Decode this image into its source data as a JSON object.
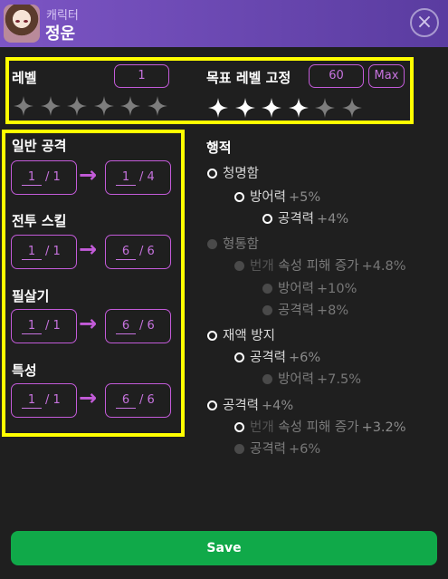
{
  "header": {
    "subtitle": "캐릭터",
    "name": "정운",
    "close_icon": "×"
  },
  "level": {
    "label": "레벨",
    "value": "1"
  },
  "target": {
    "label": "목표 레벨 고정",
    "value": "60",
    "max_label": "Max"
  },
  "level_stars": {
    "total": 6,
    "filled": 0
  },
  "target_stars": {
    "total": 6,
    "filled": 4
  },
  "skills": [
    {
      "label": "일반 공격",
      "from_cur": "1",
      "from_max": "1",
      "to_cur": "1",
      "to_max": "4"
    },
    {
      "label": "전투 스킬",
      "from_cur": "1",
      "from_max": "1",
      "to_cur": "6",
      "to_max": "6"
    },
    {
      "label": "필살기",
      "from_cur": "1",
      "from_max": "1",
      "to_cur": "6",
      "to_max": "6"
    },
    {
      "label": "특성",
      "from_cur": "1",
      "from_max": "1",
      "to_cur": "6",
      "to_max": "6"
    }
  ],
  "arrow_symbol": "→",
  "slash": "/",
  "traces": {
    "title": "행적",
    "nodes": [
      {
        "label": "청명함",
        "bonus": "",
        "active": true
      },
      {
        "label": "방어력",
        "bonus": "+5%",
        "active": true
      },
      {
        "label": "공격력",
        "bonus": "+4%",
        "active": true
      },
      {
        "label": "형통함",
        "bonus": "",
        "active": false
      },
      {
        "prefix": "번개",
        "label": "속성 피해 증가",
        "bonus": "+4.8%",
        "active": false
      },
      {
        "label": "방어력",
        "bonus": "+10%",
        "active": false
      },
      {
        "label": "공격력",
        "bonus": "+8%",
        "active": false
      },
      {
        "label": "재액 방지",
        "bonus": "",
        "active": true
      },
      {
        "label": "공격력",
        "bonus": "+6%",
        "active": true
      },
      {
        "label": "방어력",
        "bonus": "+7.5%",
        "active": false
      },
      {
        "label": "공격력",
        "bonus": "+4%",
        "active": true
      },
      {
        "prefix": "번개",
        "label": "속성 피해 증가",
        "bonus": "+3.2%",
        "active": true
      },
      {
        "label": "공격력",
        "bonus": "+6%",
        "active": false
      }
    ]
  },
  "save_label": "Save",
  "colors": {
    "accent": "#c35bd9",
    "highlight": "#ffff00",
    "save": "#10a949"
  }
}
